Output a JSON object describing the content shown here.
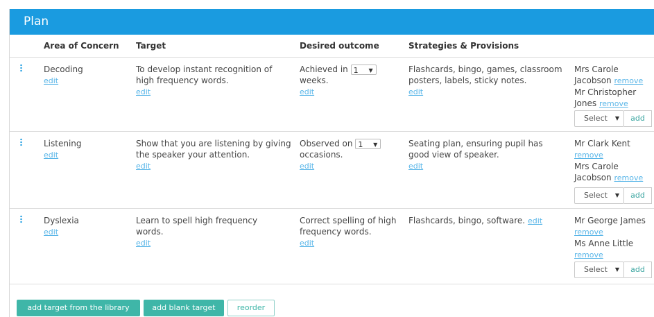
{
  "panel": {
    "title": "Plan"
  },
  "columns": {
    "area": "Area of Concern",
    "target": "Target",
    "outcome": "Desired outcome",
    "strategies": "Strategies & Provisions"
  },
  "rows": [
    {
      "area": "Decoding",
      "area_edit": "edit",
      "target": "To develop instant recognition of high frequency words.",
      "target_edit": "edit",
      "outcome_prefix": "Achieved in",
      "outcome_select": "1",
      "outcome_suffix": "weeks.",
      "outcome_edit": "edit",
      "strategies": "Flashcards, bingo, games, classroom posters, labels, sticky notes.",
      "strategies_edit": "edit",
      "people": [
        {
          "name": "Mrs Carole Jacobson",
          "remove": "remove"
        },
        {
          "name": "Mr Christopher Jones",
          "remove": "remove"
        }
      ],
      "select_label": "Select",
      "add_label": "add"
    },
    {
      "area": "Listening",
      "area_edit": "edit",
      "target": "Show that you are listening by giving the speaker your attention.",
      "target_edit": "edit",
      "outcome_prefix": "Observed on",
      "outcome_select": "1",
      "outcome_suffix": "occasions.",
      "outcome_edit": "edit",
      "strategies": "Seating plan, ensuring pupil has good view of speaker.",
      "strategies_edit": "edit",
      "people": [
        {
          "name": "Mr Clark Kent",
          "remove": "remove"
        },
        {
          "name": "Mrs Carole Jacobson",
          "remove": "remove"
        }
      ],
      "select_label": "Select",
      "add_label": "add"
    },
    {
      "area": "Dyslexia",
      "area_edit": "edit",
      "target": "Learn to spell high frequency words.",
      "target_edit": "edit",
      "outcome_text": "Correct spelling of high frequency words.",
      "outcome_edit": "edit",
      "strategies": "Flashcards, bingo, software.",
      "strategies_edit": "edit",
      "people": [
        {
          "name": "Mr George James",
          "remove": "remove"
        },
        {
          "name": "Ms Anne Little",
          "remove": "remove"
        }
      ],
      "select_label": "Select",
      "add_label": "add"
    }
  ],
  "footer": {
    "library_button": "add target from the library",
    "blank_button": "add blank target",
    "reorder_button": "reorder"
  },
  "colors": {
    "header": "#1a9be0",
    "teal": "#3fb6a8",
    "link": "#5ab6e8"
  },
  "icons": {
    "drag": "drag-handle-icon",
    "caret": "caret-down-icon"
  }
}
